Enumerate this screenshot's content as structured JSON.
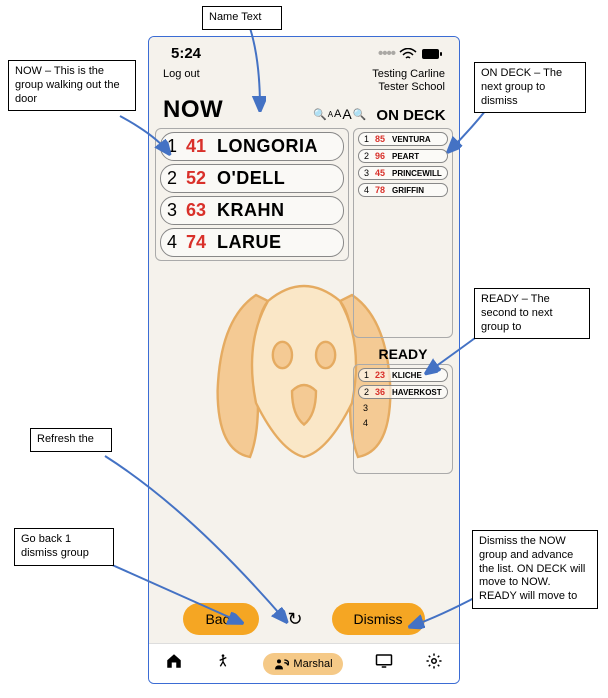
{
  "statusBar": {
    "time": "5:24"
  },
  "header": {
    "logout": "Log out",
    "schoolLine1": "Testing Carline",
    "schoolLine2": "Tester School",
    "nowLabel": "NOW",
    "onDeckLabel": "ON DECK",
    "readyLabel": "READY"
  },
  "zoom": {
    "aSmall": "A",
    "aMed": "A",
    "aBig": "A"
  },
  "now": [
    {
      "idx": "1",
      "num": "41",
      "name": "LONGORIA"
    },
    {
      "idx": "2",
      "num": "52",
      "name": "O'DELL"
    },
    {
      "idx": "3",
      "num": "63",
      "name": "KRAHN"
    },
    {
      "idx": "4",
      "num": "74",
      "name": "LARUE"
    }
  ],
  "onDeck": [
    {
      "idx": "1",
      "num": "85",
      "name": "VENTURA"
    },
    {
      "idx": "2",
      "num": "96",
      "name": "PEART"
    },
    {
      "idx": "3",
      "num": "45",
      "name": "PRINCEWILL"
    },
    {
      "idx": "4",
      "num": "78",
      "name": "GRIFFIN"
    }
  ],
  "ready": [
    {
      "idx": "1",
      "num": "23",
      "name": "KLICHE"
    },
    {
      "idx": "2",
      "num": "36",
      "name": "HAVERKOST"
    },
    {
      "idx": "3",
      "num": "",
      "name": ""
    },
    {
      "idx": "4",
      "num": "",
      "name": ""
    }
  ],
  "buttons": {
    "back": "Back",
    "dismiss": "Dismiss"
  },
  "nav": {
    "marshal": "Marshal"
  },
  "callouts": {
    "nameText": "Name Text",
    "now": "NOW – This is the group walking out the door",
    "onDeck": "ON DECK – The next group to dismiss",
    "ready": "READY – The second to next group to",
    "refresh": "Refresh the",
    "back": "Go back 1 dismiss group",
    "dismiss": "Dismiss the NOW group and advance the list.  ON DECK will move to NOW.  READY will move to"
  }
}
